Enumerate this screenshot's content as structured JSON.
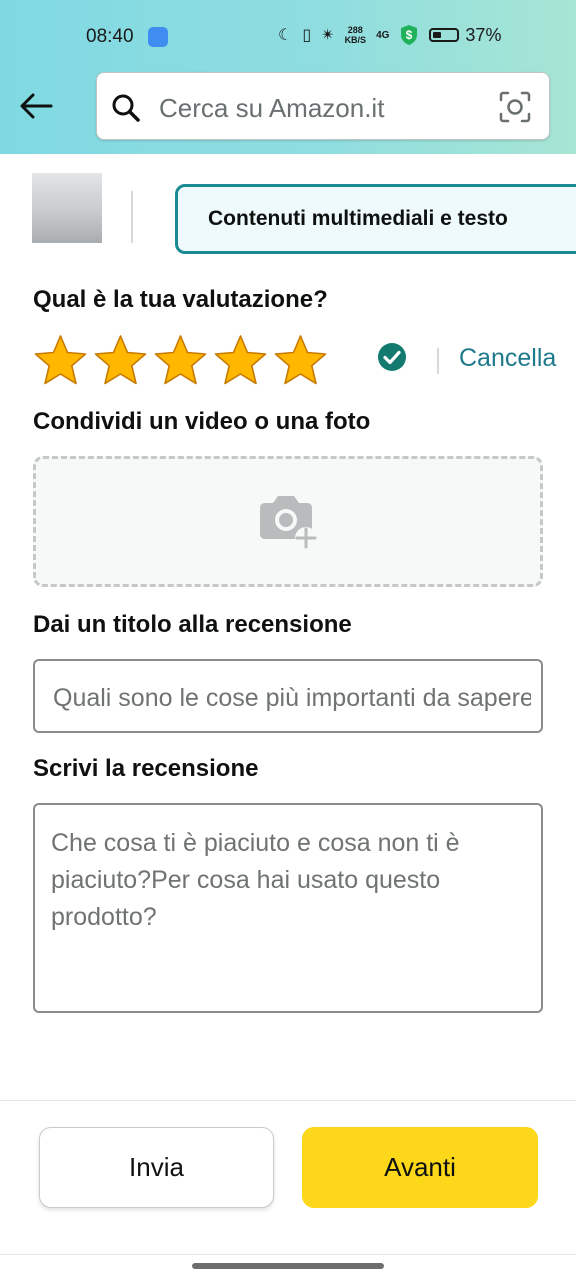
{
  "status_bar": {
    "time": "08:40",
    "speed_value": "288",
    "speed_unit": "KB/S",
    "network": "4G",
    "battery_percent": "37%",
    "battery_level": 0.37
  },
  "search": {
    "placeholder": "Cerca su Amazon.it"
  },
  "tabs": {
    "active_label": "Contenuti multimediali e testo"
  },
  "rating": {
    "question": "Qual è la tua valutazione?",
    "stars_selected": 5,
    "stars_total": 5,
    "cancel_label": "Cancella",
    "star_color": "#ffb700"
  },
  "media": {
    "label": "Condividi un video o una foto"
  },
  "title_section": {
    "label": "Dai un titolo alla recensione",
    "placeholder": "Quali sono le cose più importanti da sapere?"
  },
  "review_section": {
    "label": "Scrivi la recensione",
    "placeholder": "Che cosa ti è piaciuto e cosa non ti è piaciuto?Per cosa hai usato questo prodotto?"
  },
  "buttons": {
    "submit_label": "Invia",
    "next_label": "Avanti"
  },
  "colors": {
    "accent_teal": "#1a8b94",
    "link": "#1f7a8c",
    "primary_button": "#fcd71a"
  }
}
